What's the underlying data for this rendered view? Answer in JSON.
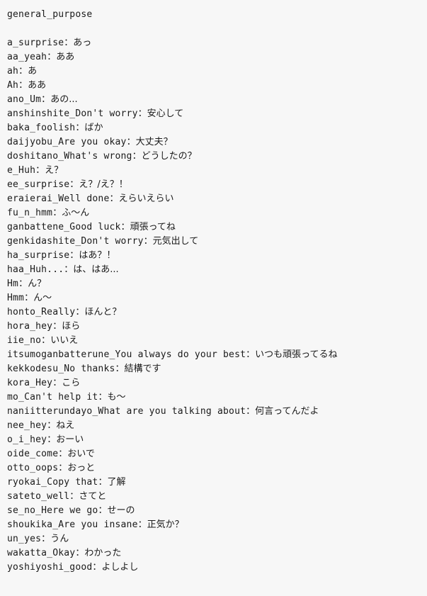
{
  "panel": {
    "group_title": "general_purpose",
    "separator": "：",
    "background_color": "#f7f7f7",
    "text_color": "#1a1a1a"
  },
  "entries": [
    {
      "key": "a_surprise",
      "value": "あっ"
    },
    {
      "key": "aa_yeah",
      "value": "ああ"
    },
    {
      "key": "ah",
      "value": "あ"
    },
    {
      "key": "Ah",
      "value": "ああ"
    },
    {
      "key": "ano_Um",
      "value": "あの..."
    },
    {
      "key": "anshinshite_Don't worry",
      "value": "安心して"
    },
    {
      "key": "baka_foolish",
      "value": "ばか"
    },
    {
      "key": "daijyobu_Are you okay",
      "value": "大丈夫？"
    },
    {
      "key": "doshitano_What's wrong",
      "value": "どうしたの？"
    },
    {
      "key": "e_Huh",
      "value": "え？"
    },
    {
      "key": "ee_surprise",
      "value": "え？/え？！"
    },
    {
      "key": "eraierai_Well done",
      "value": "えらいえらい"
    },
    {
      "key": "fu_n_hmm",
      "value": "ふ〜ん"
    },
    {
      "key": "ganbattene_Good luck",
      "value": "頑張ってね"
    },
    {
      "key": "genkidashite_Don't worry",
      "value": "元気出して"
    },
    {
      "key": "ha_surprise",
      "value": "はあ？！"
    },
    {
      "key": "haa_Huh...",
      "value": "は、はあ..."
    },
    {
      "key": "Hm",
      "value": "ん？"
    },
    {
      "key": "Hmm",
      "value": "ん〜"
    },
    {
      "key": "honto_Really",
      "value": "ほんと？"
    },
    {
      "key": "hora_hey",
      "value": "ほら"
    },
    {
      "key": "iie_no",
      "value": "いいえ"
    },
    {
      "key": "itsumoganbatterune_You always do your best",
      "value": "いつも頑張ってるね"
    },
    {
      "key": "kekkodesu_No thanks",
      "value": "結構です"
    },
    {
      "key": "kora_Hey",
      "value": "こら"
    },
    {
      "key": "mo_Can't help it",
      "value": "も〜"
    },
    {
      "key": "naniitterundayo_What are you talking about",
      "value": "何言ってんだよ"
    },
    {
      "key": "nee_hey",
      "value": "ねえ"
    },
    {
      "key": "o_i_hey",
      "value": "おーい"
    },
    {
      "key": "oide_come",
      "value": "おいで"
    },
    {
      "key": "otto_oops",
      "value": "おっと"
    },
    {
      "key": "ryokai_Copy that",
      "value": "了解"
    },
    {
      "key": "sateto_well",
      "value": "さてと"
    },
    {
      "key": "se_no_Here we go",
      "value": "せーの"
    },
    {
      "key": "shoukika_Are you insane",
      "value": "正気か？"
    },
    {
      "key": "un_yes",
      "value": "うん"
    },
    {
      "key": "wakatta_Okay",
      "value": "わかった"
    },
    {
      "key": "yoshiyoshi_good",
      "value": "よしよし"
    }
  ]
}
